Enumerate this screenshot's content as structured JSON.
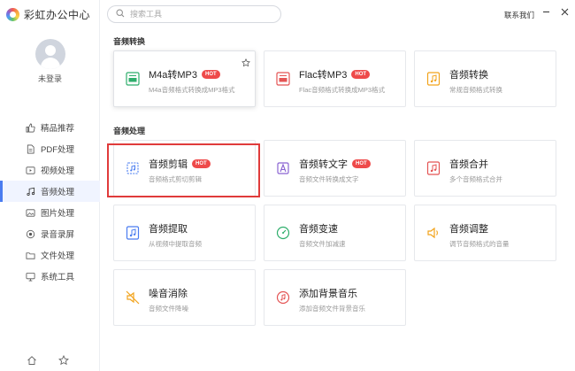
{
  "app": {
    "title": "彩虹办公中心"
  },
  "user": {
    "status": "未登录"
  },
  "search": {
    "placeholder": "搜索工具"
  },
  "header": {
    "contact": "联系我们"
  },
  "sidebar": {
    "items": [
      {
        "label": "精品推荐",
        "icon": "thumbs-up-icon"
      },
      {
        "label": "PDF处理",
        "icon": "pdf-file-icon"
      },
      {
        "label": "视频处理",
        "icon": "video-icon"
      },
      {
        "label": "音频处理",
        "icon": "music-note-icon",
        "active": true
      },
      {
        "label": "图片处理",
        "icon": "image-icon"
      },
      {
        "label": "录音录屏",
        "icon": "record-icon"
      },
      {
        "label": "文件处理",
        "icon": "folder-icon"
      },
      {
        "label": "系统工具",
        "icon": "monitor-icon"
      }
    ]
  },
  "sections": [
    {
      "title": "音频转换",
      "cards": [
        {
          "title": "M4a转MP3",
          "hot": "HOT",
          "desc": "M4a音频格式转换成MP3格式",
          "icon": "m4a-convert-icon"
        },
        {
          "title": "Flac转MP3",
          "hot": "HOT",
          "desc": "Flac音频格式转换成MP3格式",
          "icon": "flac-convert-icon"
        },
        {
          "title": "音频转换",
          "desc": "常规音频格式转换",
          "icon": "audio-file-icon"
        }
      ]
    },
    {
      "title": "音频处理",
      "cards": [
        {
          "title": "音频剪辑",
          "hot": "HOT",
          "desc": "音频格式剪切剪辑",
          "icon": "audio-cut-icon"
        },
        {
          "title": "音频转文字",
          "hot": "HOT",
          "desc": "音频文件转换成文字",
          "icon": "audio-to-text-icon"
        },
        {
          "title": "音频合并",
          "desc": "多个音频格式合并",
          "icon": "audio-merge-icon"
        },
        {
          "title": "音频提取",
          "desc": "从视频中提取音频",
          "icon": "audio-extract-icon"
        },
        {
          "title": "音频变速",
          "desc": "音频文件加减速",
          "icon": "speed-dial-icon"
        },
        {
          "title": "音频调整",
          "desc": "调节音频格式的音量",
          "icon": "volume-icon"
        },
        {
          "title": "噪音消除",
          "desc": "音频文件降噪",
          "icon": "noise-reduce-icon"
        },
        {
          "title": "添加背景音乐",
          "desc": "添加音频文件背景音乐",
          "icon": "bgm-icon"
        }
      ]
    }
  ],
  "colors": {
    "accent": "#4a7cf0",
    "hot": "#ee4a4a",
    "highlight": "#e03b3b"
  }
}
